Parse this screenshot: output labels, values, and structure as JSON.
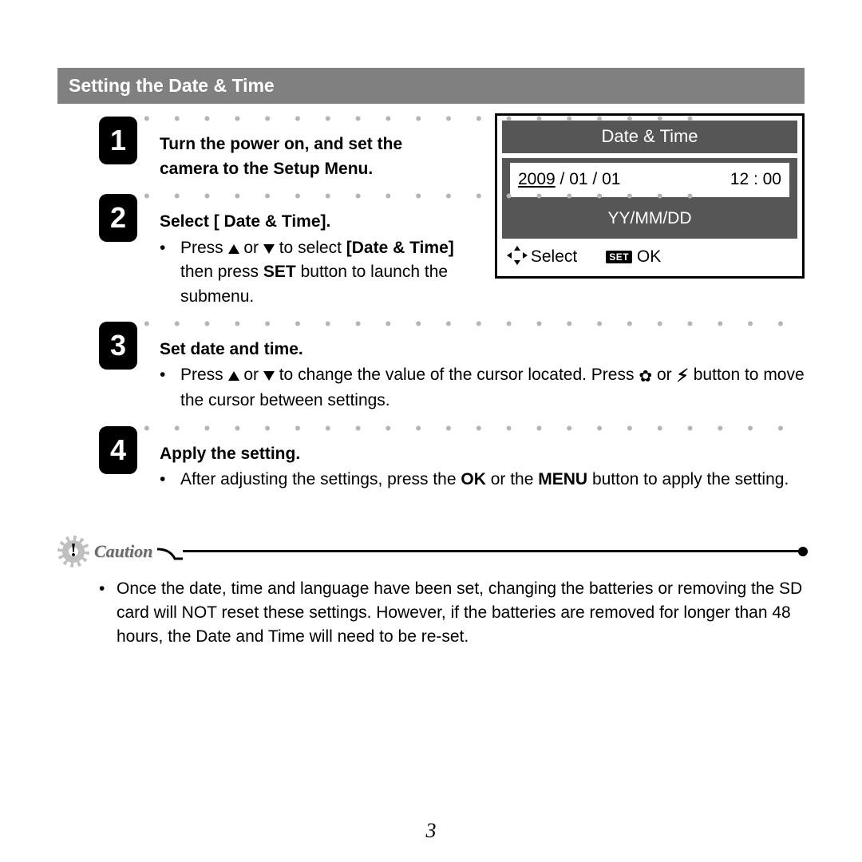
{
  "section_title": "Setting the Date & Time",
  "lcd": {
    "title": "Date & Time",
    "year": "2009",
    "date_rest": " / 01 / 01",
    "time": "12 : 00",
    "format": "YY/MM/DD",
    "footer_select": "Select",
    "footer_ok": "OK",
    "footer_set_chip": "SET"
  },
  "steps": [
    {
      "num": "1",
      "title": "Turn the power on, and set the camera to the Setup Menu.",
      "bullets": []
    },
    {
      "num": "2",
      "title": "Select [ Date & Time].",
      "bullets": [
        {
          "pre": "Press ",
          "mid": " or ",
          "post1": " to select ",
          "b1": "[Date & Time]",
          "post2": " then press ",
          "b2": "SET",
          "post3": " button to launch the submenu."
        }
      ]
    },
    {
      "num": "3",
      "title": "Set date and time.",
      "bullets": [
        {
          "pre": "Press ",
          "mid": " or ",
          "post1": " to change the value of the cursor located.  Press ",
          "post2": " or ",
          "post3": " button to move the cursor between settings."
        }
      ]
    },
    {
      "num": "4",
      "title": "Apply the setting.",
      "bullets": [
        {
          "pre": "After adjusting the settings, press the ",
          "b1": "OK",
          "mid": " or the ",
          "b2": "MENU",
          "post3": " button to apply the setting."
        }
      ]
    }
  ],
  "caution": {
    "label": "Caution",
    "text": "Once the date, time and language have been set, changing the batteries or removing the SD card will NOT reset these settings. However, if the batteries are removed for longer than 48 hours, the Date and Time will need to be re-set."
  },
  "page_number": "3"
}
